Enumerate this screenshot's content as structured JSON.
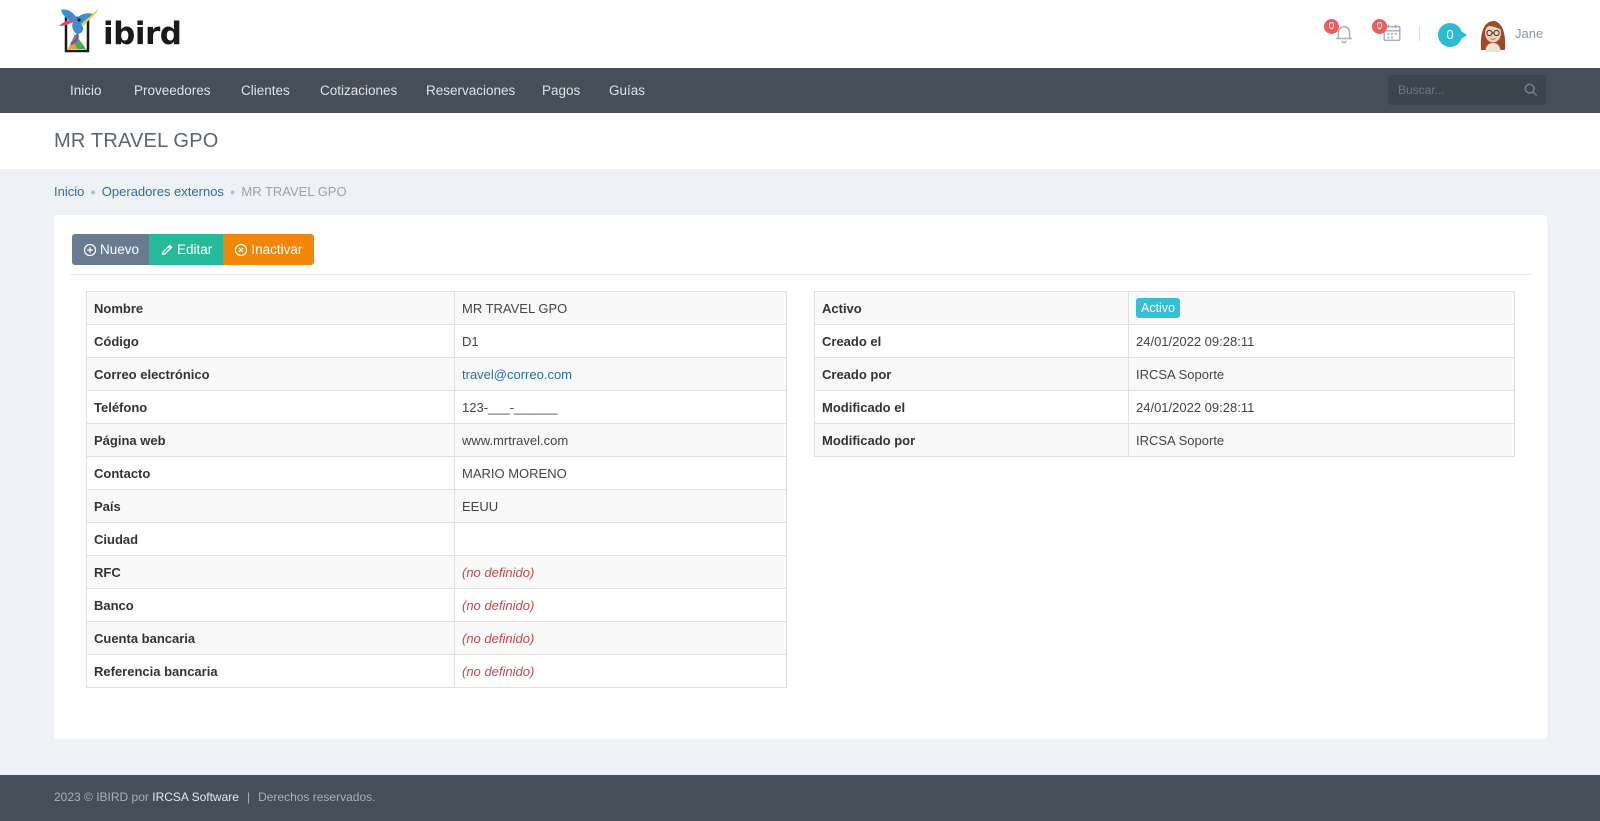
{
  "brand": {
    "name": "ibird"
  },
  "topbar": {
    "notifications_count": "0",
    "calendar_count": "0",
    "messages_count": "0",
    "user_name": "Jane"
  },
  "nav": {
    "items": [
      "Inicio",
      "Proveedores",
      "Clientes",
      "Cotizaciones",
      "Reservaciones",
      "Pagos",
      "Guías"
    ],
    "search_placeholder": "Buscar..."
  },
  "page": {
    "title": "MR TRAVEL GPO"
  },
  "breadcrumb": {
    "items": [
      "Inicio",
      "Operadores externos"
    ],
    "current": "MR TRAVEL GPO"
  },
  "actions": {
    "nuevo": "Nuevo",
    "editar": "Editar",
    "inactivar": "Inactivar"
  },
  "details_left": [
    {
      "label": "Nombre",
      "value": "MR TRAVEL GPO"
    },
    {
      "label": "Código",
      "value": "D1"
    },
    {
      "label": "Correo electrónico",
      "value": "travel@correo.com"
    },
    {
      "label": "Teléfono",
      "value": "123-___-______"
    },
    {
      "label": "Página web",
      "value": "www.mrtravel.com"
    },
    {
      "label": "Contacto",
      "value": "MARIO MORENO"
    },
    {
      "label": "País",
      "value": "EEUU"
    },
    {
      "label": "Ciudad",
      "value": ""
    },
    {
      "label": "RFC",
      "value": "(no definido)"
    },
    {
      "label": "Banco",
      "value": "(no definido)"
    },
    {
      "label": "Cuenta bancaria",
      "value": "(no definido)"
    },
    {
      "label": "Referencia bancaria",
      "value": "(no definido)"
    }
  ],
  "details_right": [
    {
      "label": "Activo",
      "value": "Activo"
    },
    {
      "label": "Creado el",
      "value": "24/01/2022 09:28:11"
    },
    {
      "label": "Creado por",
      "value": "IRCSA Soporte"
    },
    {
      "label": "Modificado el",
      "value": "24/01/2022 09:28:11"
    },
    {
      "label": "Modificado por",
      "value": "IRCSA Soporte"
    }
  ],
  "footer": {
    "prefix": "2023 © IBIRD por ",
    "company": "IRCSA Software",
    "separator": "|",
    "rights": "Derechos reservados."
  },
  "colors": {
    "navbar": "#454e59",
    "link": "#2e6da4",
    "btn_nuevo": "#687b93",
    "btn_editar": "#26b99a",
    "btn_inactivar": "#f0870b",
    "badge_activo": "#34bfd5",
    "undefined_text": "#c0484e",
    "notification_badge": "#ef5b5b"
  }
}
